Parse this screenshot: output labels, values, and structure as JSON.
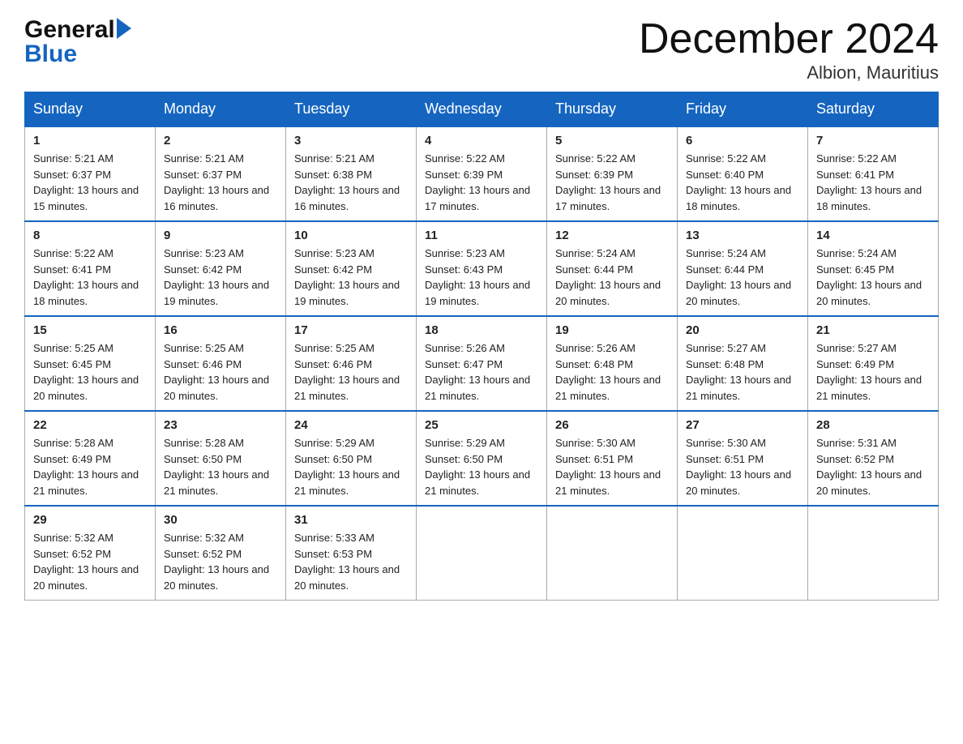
{
  "header": {
    "logo_general": "General",
    "logo_blue": "Blue",
    "title": "December 2024",
    "subtitle": "Albion, Mauritius"
  },
  "days_of_week": [
    "Sunday",
    "Monday",
    "Tuesday",
    "Wednesday",
    "Thursday",
    "Friday",
    "Saturday"
  ],
  "weeks": [
    [
      {
        "day": "1",
        "sunrise": "5:21 AM",
        "sunset": "6:37 PM",
        "daylight": "13 hours and 15 minutes."
      },
      {
        "day": "2",
        "sunrise": "5:21 AM",
        "sunset": "6:37 PM",
        "daylight": "13 hours and 16 minutes."
      },
      {
        "day": "3",
        "sunrise": "5:21 AM",
        "sunset": "6:38 PM",
        "daylight": "13 hours and 16 minutes."
      },
      {
        "day": "4",
        "sunrise": "5:22 AM",
        "sunset": "6:39 PM",
        "daylight": "13 hours and 17 minutes."
      },
      {
        "day": "5",
        "sunrise": "5:22 AM",
        "sunset": "6:39 PM",
        "daylight": "13 hours and 17 minutes."
      },
      {
        "day": "6",
        "sunrise": "5:22 AM",
        "sunset": "6:40 PM",
        "daylight": "13 hours and 18 minutes."
      },
      {
        "day": "7",
        "sunrise": "5:22 AM",
        "sunset": "6:41 PM",
        "daylight": "13 hours and 18 minutes."
      }
    ],
    [
      {
        "day": "8",
        "sunrise": "5:22 AM",
        "sunset": "6:41 PM",
        "daylight": "13 hours and 18 minutes."
      },
      {
        "day": "9",
        "sunrise": "5:23 AM",
        "sunset": "6:42 PM",
        "daylight": "13 hours and 19 minutes."
      },
      {
        "day": "10",
        "sunrise": "5:23 AM",
        "sunset": "6:42 PM",
        "daylight": "13 hours and 19 minutes."
      },
      {
        "day": "11",
        "sunrise": "5:23 AM",
        "sunset": "6:43 PM",
        "daylight": "13 hours and 19 minutes."
      },
      {
        "day": "12",
        "sunrise": "5:24 AM",
        "sunset": "6:44 PM",
        "daylight": "13 hours and 20 minutes."
      },
      {
        "day": "13",
        "sunrise": "5:24 AM",
        "sunset": "6:44 PM",
        "daylight": "13 hours and 20 minutes."
      },
      {
        "day": "14",
        "sunrise": "5:24 AM",
        "sunset": "6:45 PM",
        "daylight": "13 hours and 20 minutes."
      }
    ],
    [
      {
        "day": "15",
        "sunrise": "5:25 AM",
        "sunset": "6:45 PM",
        "daylight": "13 hours and 20 minutes."
      },
      {
        "day": "16",
        "sunrise": "5:25 AM",
        "sunset": "6:46 PM",
        "daylight": "13 hours and 20 minutes."
      },
      {
        "day": "17",
        "sunrise": "5:25 AM",
        "sunset": "6:46 PM",
        "daylight": "13 hours and 21 minutes."
      },
      {
        "day": "18",
        "sunrise": "5:26 AM",
        "sunset": "6:47 PM",
        "daylight": "13 hours and 21 minutes."
      },
      {
        "day": "19",
        "sunrise": "5:26 AM",
        "sunset": "6:48 PM",
        "daylight": "13 hours and 21 minutes."
      },
      {
        "day": "20",
        "sunrise": "5:27 AM",
        "sunset": "6:48 PM",
        "daylight": "13 hours and 21 minutes."
      },
      {
        "day": "21",
        "sunrise": "5:27 AM",
        "sunset": "6:49 PM",
        "daylight": "13 hours and 21 minutes."
      }
    ],
    [
      {
        "day": "22",
        "sunrise": "5:28 AM",
        "sunset": "6:49 PM",
        "daylight": "13 hours and 21 minutes."
      },
      {
        "day": "23",
        "sunrise": "5:28 AM",
        "sunset": "6:50 PM",
        "daylight": "13 hours and 21 minutes."
      },
      {
        "day": "24",
        "sunrise": "5:29 AM",
        "sunset": "6:50 PM",
        "daylight": "13 hours and 21 minutes."
      },
      {
        "day": "25",
        "sunrise": "5:29 AM",
        "sunset": "6:50 PM",
        "daylight": "13 hours and 21 minutes."
      },
      {
        "day": "26",
        "sunrise": "5:30 AM",
        "sunset": "6:51 PM",
        "daylight": "13 hours and 21 minutes."
      },
      {
        "day": "27",
        "sunrise": "5:30 AM",
        "sunset": "6:51 PM",
        "daylight": "13 hours and 20 minutes."
      },
      {
        "day": "28",
        "sunrise": "5:31 AM",
        "sunset": "6:52 PM",
        "daylight": "13 hours and 20 minutes."
      }
    ],
    [
      {
        "day": "29",
        "sunrise": "5:32 AM",
        "sunset": "6:52 PM",
        "daylight": "13 hours and 20 minutes."
      },
      {
        "day": "30",
        "sunrise": "5:32 AM",
        "sunset": "6:52 PM",
        "daylight": "13 hours and 20 minutes."
      },
      {
        "day": "31",
        "sunrise": "5:33 AM",
        "sunset": "6:53 PM",
        "daylight": "13 hours and 20 minutes."
      },
      null,
      null,
      null,
      null
    ]
  ]
}
